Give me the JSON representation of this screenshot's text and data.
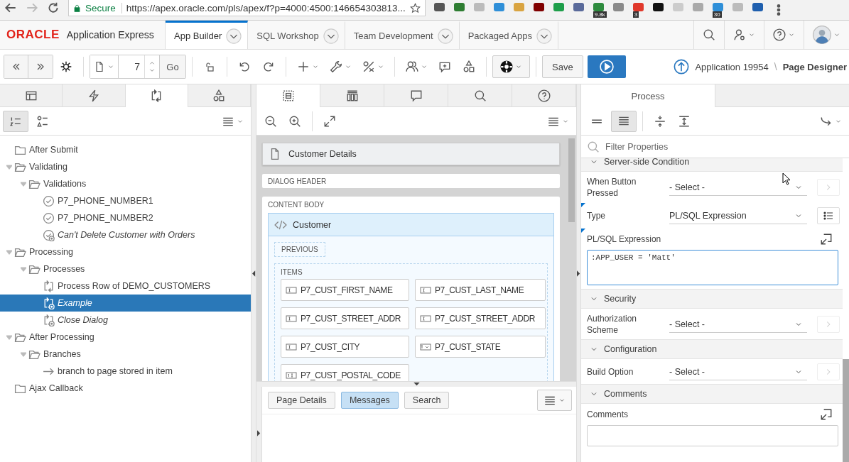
{
  "browser": {
    "secure_label": "Secure",
    "url": "https://apex.oracle.com/pls/apex/f?p=4000:4500:146654303813...",
    "extensions": [
      {
        "color": "#555555"
      },
      {
        "color": "#2e7d32"
      },
      {
        "color": "#bbbbbb"
      },
      {
        "color": "#2f8fd8"
      },
      {
        "color": "#d9a441"
      },
      {
        "color": "#800000"
      },
      {
        "color": "#1e9e4a"
      },
      {
        "color": "#5a6a9a"
      },
      {
        "color": "#2e8b3e",
        "badge": "9.8k"
      },
      {
        "color": "#8a8a8a"
      },
      {
        "color": "#e0382b",
        "badge": "3"
      },
      {
        "color": "#111111"
      },
      {
        "color": "#cccccc"
      },
      {
        "color": "#aaaaaa"
      },
      {
        "color": "#2f8fd8",
        "badge": "30"
      },
      {
        "color": "#bbbbbb"
      },
      {
        "color": "#1f5fae"
      }
    ]
  },
  "header": {
    "logo": "ORACLE",
    "product": "Application Express",
    "tabs": [
      {
        "label": "App Builder",
        "selected": true
      },
      {
        "label": "SQL Workshop",
        "selected": false
      },
      {
        "label": "Team Development",
        "selected": false
      },
      {
        "label": "Packaged Apps",
        "selected": false
      }
    ]
  },
  "toolbar": {
    "page_number": "7",
    "go_label": "Go",
    "save_label": "Save",
    "app_link": "Application 19954",
    "separator": "\\",
    "current_page": "Page Designer"
  },
  "left_panel": {
    "tabs": [
      {
        "selected": false
      },
      {
        "selected": false
      },
      {
        "selected": true
      },
      {
        "selected": false
      }
    ],
    "views": [
      {
        "selected": true
      },
      {
        "selected": false
      }
    ],
    "tree": [
      {
        "label": "After Submit",
        "kind": "folder",
        "expanded": false,
        "selected": false
      },
      {
        "label": "Validating",
        "kind": "folder",
        "expanded": true,
        "selected": false,
        "children": [
          {
            "label": "Validations",
            "kind": "folder",
            "expanded": true,
            "selected": false,
            "children": [
              {
                "label": "P7_PHONE_NUMBER1",
                "kind": "validation",
                "conditional": false,
                "selected": false
              },
              {
                "label": "P7_PHONE_NUMBER2",
                "kind": "validation",
                "conditional": false,
                "selected": false
              },
              {
                "label": "Can't Delete Customer with Orders",
                "kind": "validation",
                "conditional": true,
                "selected": false
              }
            ]
          }
        ]
      },
      {
        "label": "Processing",
        "kind": "folder",
        "expanded": true,
        "selected": false,
        "children": [
          {
            "label": "Processes",
            "kind": "folder",
            "expanded": true,
            "selected": false,
            "children": [
              {
                "label": "Process Row of DEMO_CUSTOMERS",
                "kind": "process",
                "conditional": false,
                "selected": false
              },
              {
                "label": "Example",
                "kind": "process",
                "conditional": true,
                "selected": true
              },
              {
                "label": "Close Dialog",
                "kind": "process",
                "conditional": true,
                "selected": false
              }
            ]
          }
        ]
      },
      {
        "label": "After Processing",
        "kind": "folder",
        "expanded": true,
        "selected": false,
        "children": [
          {
            "label": "Branches",
            "kind": "folder",
            "expanded": true,
            "selected": false,
            "children": [
              {
                "label": "branch to page stored in item",
                "kind": "branch",
                "conditional": false,
                "selected": false
              }
            ]
          }
        ]
      },
      {
        "label": "Ajax Callback",
        "kind": "folder",
        "expanded": false,
        "selected": false
      }
    ]
  },
  "middle_panel": {
    "tabs": [
      {
        "selected": true
      },
      {
        "selected": false
      },
      {
        "selected": false
      },
      {
        "selected": false
      },
      {
        "selected": false
      }
    ],
    "page_title": "Customer Details",
    "dialog_header": "DIALOG HEADER",
    "content_body": "CONTENT BODY",
    "region": {
      "title": "Customer",
      "buttons_position": "PREVIOUS",
      "items_position": "ITEMS",
      "items": [
        {
          "label": "P7_CUST_FIRST_NAME",
          "kind": "text"
        },
        {
          "label": "P7_CUST_LAST_NAME",
          "kind": "text"
        },
        {
          "label": "P7_CUST_STREET_ADDR",
          "kind": "text"
        },
        {
          "label": "P7_CUST_STREET_ADDR",
          "kind": "text"
        },
        {
          "label": "P7_CUST_CITY",
          "kind": "text"
        },
        {
          "label": "P7_CUST_STATE",
          "kind": "select"
        },
        {
          "label": "P7_CUST_POSTAL_CODE",
          "kind": "number"
        }
      ]
    },
    "bottom_tabs": [
      {
        "label": "Page Details",
        "selected": false
      },
      {
        "label": "Messages",
        "selected": true
      },
      {
        "label": "Search",
        "selected": false
      }
    ]
  },
  "right_panel": {
    "tabs": [
      {
        "label": "Process",
        "selected": true
      }
    ],
    "views": [
      {
        "selected": false
      },
      {
        "selected": true
      }
    ],
    "filter_placeholder": "Filter Properties",
    "sections": [
      {
        "title": "Server-side Condition",
        "expanded": true,
        "properties": [
          {
            "kind": "select",
            "label": "When Button Pressed",
            "value": "- Select -",
            "required": false
          },
          {
            "kind": "select-list",
            "label": "Type",
            "value": "PL/SQL Expression",
            "required": true
          },
          {
            "kind": "code",
            "label": "PL/SQL Expression",
            "value": ":APP_USER = 'Matt'",
            "required": true
          }
        ]
      },
      {
        "title": "Security",
        "expanded": true,
        "properties": [
          {
            "kind": "select",
            "label": "Authorization Scheme",
            "value": "- Select -",
            "required": false
          }
        ]
      },
      {
        "title": "Configuration",
        "expanded": true,
        "properties": [
          {
            "kind": "select",
            "label": "Build Option",
            "value": "- Select -",
            "required": false
          }
        ]
      },
      {
        "title": "Comments",
        "expanded": true,
        "properties": [
          {
            "kind": "text",
            "label": "Comments",
            "required": false
          }
        ]
      }
    ]
  }
}
